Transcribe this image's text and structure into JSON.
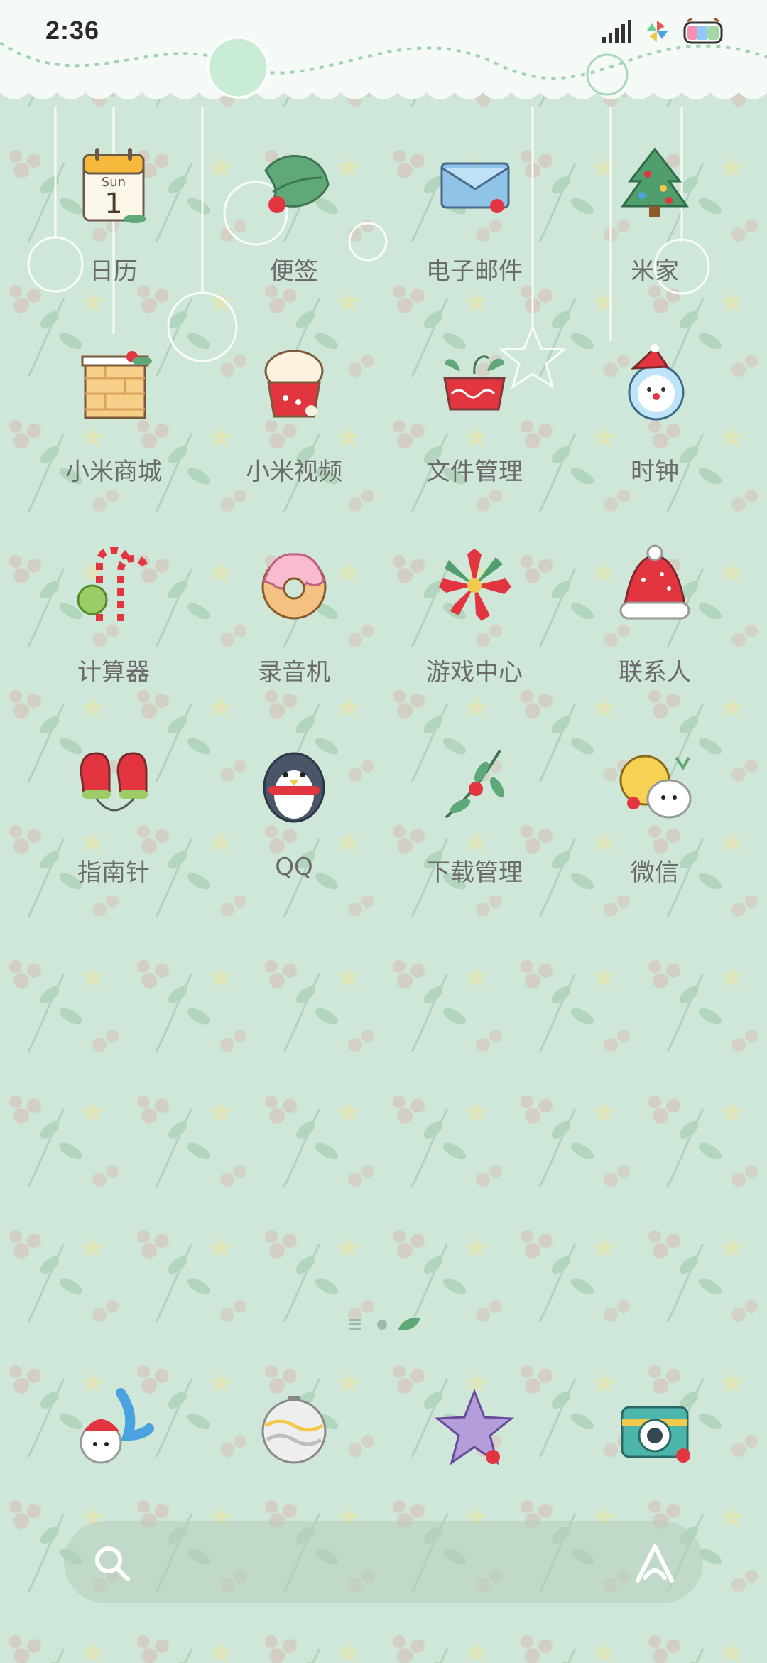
{
  "status_bar": {
    "time": "2:36",
    "icons": [
      "signal-icon",
      "pinwheel-icon",
      "battery-icon"
    ]
  },
  "apps": [
    {
      "label": "日历",
      "icon": "calendar-icon",
      "calendar_day": "Sun",
      "calendar_date": "1"
    },
    {
      "label": "便签",
      "icon": "notes-leaf-icon"
    },
    {
      "label": "电子邮件",
      "icon": "envelope-icon"
    },
    {
      "label": "米家",
      "icon": "christmas-tree-icon"
    },
    {
      "label": "小米商城",
      "icon": "gift-box-icon"
    },
    {
      "label": "小米视频",
      "icon": "popcorn-icon"
    },
    {
      "label": "文件管理",
      "icon": "plant-pot-icon"
    },
    {
      "label": "时钟",
      "icon": "snowman-clock-icon"
    },
    {
      "label": "计算器",
      "icon": "candy-cane-icon"
    },
    {
      "label": "录音机",
      "icon": "donut-icon"
    },
    {
      "label": "游戏中心",
      "icon": "poinsettia-icon"
    },
    {
      "label": "联系人",
      "icon": "santa-hat-icon"
    },
    {
      "label": "指南针",
      "icon": "mittens-icon"
    },
    {
      "label": "QQ",
      "icon": "penguin-icon"
    },
    {
      "label": "下载管理",
      "icon": "berry-branch-icon"
    },
    {
      "label": "微信",
      "icon": "buddies-icon"
    }
  ],
  "dock": [
    {
      "icon": "phone-santa-icon"
    },
    {
      "icon": "ornament-ball-icon"
    },
    {
      "icon": "star-icon"
    },
    {
      "icon": "camera-icon"
    }
  ],
  "search": {
    "search_icon": "search-icon",
    "assistant_icon": "assistant-icon"
  },
  "colors": {
    "background": "#cfe7d8",
    "label": "#6b6b6b",
    "accent_red": "#e2353f",
    "accent_green": "#5fa878"
  }
}
